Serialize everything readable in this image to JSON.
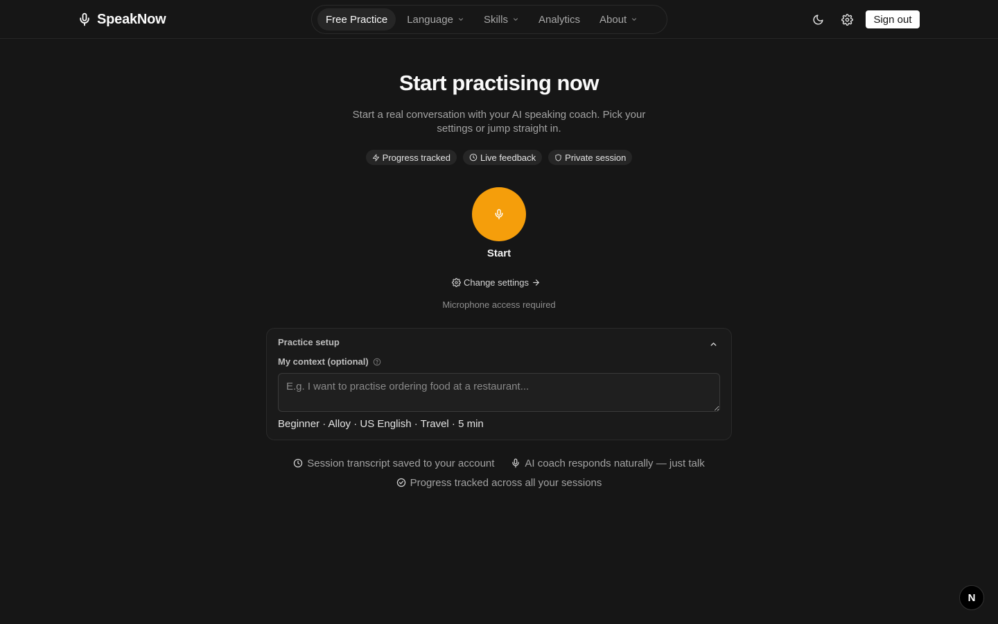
{
  "header": {
    "brand": "SpeakNow",
    "nav": [
      {
        "label": "Free Practice",
        "active": true,
        "dropdown": false
      },
      {
        "label": "Language",
        "active": false,
        "dropdown": true
      },
      {
        "label": "Skills",
        "active": false,
        "dropdown": true
      },
      {
        "label": "Analytics",
        "active": false,
        "dropdown": false
      },
      {
        "label": "About",
        "active": false,
        "dropdown": true
      }
    ],
    "theme_icon": "moon-icon",
    "settings_icon": "gear-icon",
    "sign_out": "Sign out"
  },
  "hero": {
    "title": "Start practising now",
    "subtitle": "Start a real conversation with your AI speaking coach. Pick your settings or jump straight in.",
    "chips": [
      {
        "icon": "lightning-icon",
        "label": "Progress tracked"
      },
      {
        "icon": "clock-icon",
        "label": "Live feedback"
      },
      {
        "icon": "shield-icon",
        "label": "Private session"
      }
    ],
    "start_label": "Start",
    "change_settings": "Change settings",
    "mic_note": "Microphone access required"
  },
  "setup": {
    "title": "Practice setup",
    "context_label": "My context (optional)",
    "context_value": "",
    "context_placeholder": "E.g. I want to practise ordering food at a restaurant...",
    "summary": "Beginner · Alloy · US English · Travel · 5 min"
  },
  "features": [
    {
      "icon": "clock-icon",
      "text": "Session transcript saved to your account"
    },
    {
      "icon": "microphone-icon",
      "text": "AI coach responds naturally — just talk"
    },
    {
      "icon": "check-circle-icon",
      "text": "Progress tracked across all your sessions"
    }
  ],
  "badge": "N",
  "colors": {
    "background": "#161616",
    "accent": "#f59e0b",
    "card": "#1a1a1a"
  }
}
